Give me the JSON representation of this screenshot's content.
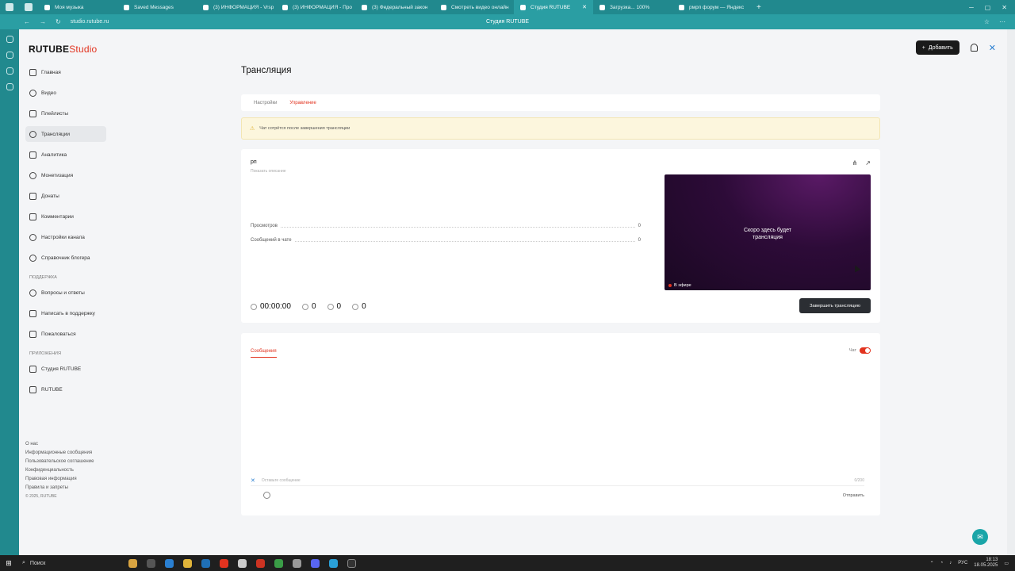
{
  "browser": {
    "tabs": [
      {
        "label": "Моя музыка",
        "active": false
      },
      {
        "label": "Saved Messages",
        "active": false
      },
      {
        "label": "(3) ИНФОРМАЦИЯ - Vrsp",
        "active": false
      },
      {
        "label": "(3) ИНФОРМАЦИЯ - Про",
        "active": false
      },
      {
        "label": "(3) Федеральный закон",
        "active": false
      },
      {
        "label": "Смотреть видео онлайн",
        "active": false
      },
      {
        "label": "Студия RUTUBE",
        "active": true
      },
      {
        "label": "Загрузка... 100%",
        "active": false
      },
      {
        "label": "рмрп форум — Яндекс",
        "active": false
      }
    ],
    "url": "studio.rutube.ru",
    "page_title": "Студия RUTUBE"
  },
  "logo": {
    "brand": "RUTUBE",
    "product": "Studio"
  },
  "sidebar": {
    "items": [
      {
        "label": "Главная"
      },
      {
        "label": "Видео"
      },
      {
        "label": "Плейлисты"
      },
      {
        "label": "Трансляции",
        "active": true
      },
      {
        "label": "Аналитика"
      },
      {
        "label": "Монетизация"
      },
      {
        "label": "Донаты"
      },
      {
        "label": "Комментарии"
      },
      {
        "label": "Настройки канала"
      },
      {
        "label": "Справочник блогера"
      }
    ],
    "support_heading": "ПОДДЕРЖКА",
    "support_items": [
      {
        "label": "Вопросы и ответы"
      },
      {
        "label": "Написать в поддержку"
      },
      {
        "label": "Пожаловаться"
      }
    ],
    "apps_heading": "ПРИЛОЖЕНИЯ",
    "app_items": [
      {
        "label": "Студия RUTUBE"
      },
      {
        "label": "RUTUBE"
      }
    ],
    "footer_links": [
      "О нас",
      "Информационные сообщения",
      "Пользовательское соглашение",
      "Конфиденциальность",
      "Правовая информация",
      "Правила и запреты"
    ],
    "copyright": "© 2025, RUTUBE"
  },
  "header": {
    "add_label": "Добавить"
  },
  "page": {
    "title": "Трансляция",
    "tabs": [
      {
        "label": "Настройки",
        "active": false
      },
      {
        "label": "Управление",
        "active": true
      }
    ],
    "warning": "Чат сотрётся после завершения трансляции"
  },
  "stream": {
    "title": "рп",
    "show_description": "Показать описание",
    "stats": [
      {
        "label": "Просмотров",
        "value": "0"
      },
      {
        "label": "Сообщений в чате",
        "value": "0"
      }
    ],
    "duration": "00:00:00",
    "viewers": "0",
    "likes": "0",
    "dislikes": "0",
    "player_text_line1": "Скоро здесь будет",
    "player_text_line2": "трансляция",
    "live_label": "В эфире",
    "end_button": "Завершить трансляцию"
  },
  "chat": {
    "tab_label": "Сообщения",
    "toggle_label": "Чат",
    "toggle_on": true,
    "input_placeholder": "Оставьте сообщение",
    "counter": "0/200",
    "send_label": "Отправить"
  },
  "taskbar": {
    "search_label": "Поиск",
    "lang": "РУС",
    "time": "18:13",
    "date": "18.05.2025"
  },
  "colors": {
    "accent": "#e2331f",
    "browser_chrome": "#21898e",
    "warning_bg": "#fcf6dd"
  }
}
